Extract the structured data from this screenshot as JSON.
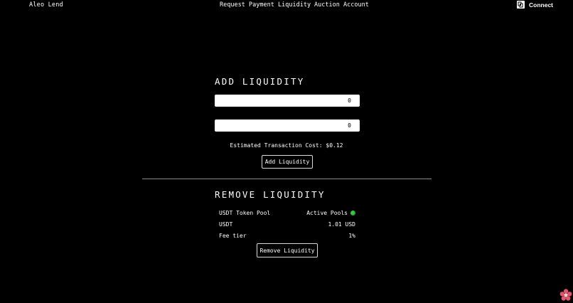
{
  "header": {
    "brand": "Aleo Lend",
    "nav": [
      "Request",
      "Payment",
      "Liquidity",
      "Auction",
      "Account"
    ],
    "connect_label": "Connect",
    "connect_icon": "wallet-icon"
  },
  "add_liquidity": {
    "title": "ADD LIQUIDITY",
    "amount_1_value": "0",
    "amount_2_value": "0",
    "estimated_cost": "Estimated Transaction Cost: $0.12",
    "button_label": "Add Liquidity"
  },
  "remove_liquidity": {
    "title": "REMOVE LIQUIDITY",
    "pool_name": "USDT Token Pool",
    "pool_status": "Active Pools",
    "status_color": "#2ecc40",
    "asset": "USDT",
    "asset_value": "1.01 USD",
    "fee_label": "Fee tier",
    "fee_value": "1%",
    "button_label": "Remove Liquidity"
  },
  "floating_icon": "flower-icon"
}
